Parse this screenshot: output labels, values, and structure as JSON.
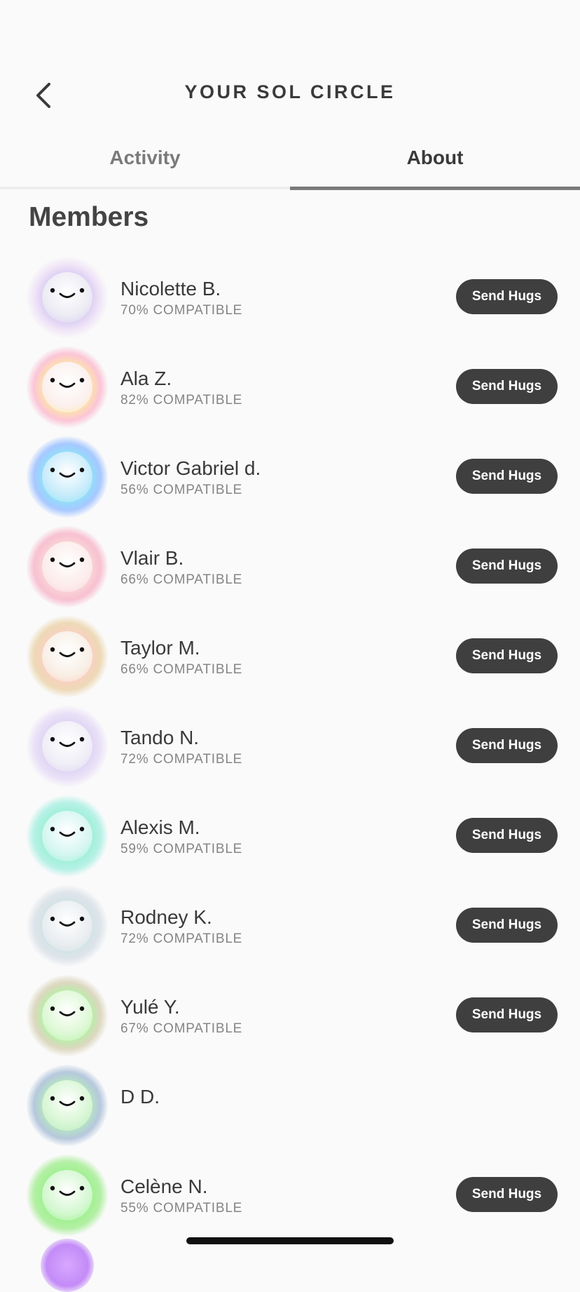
{
  "header": {
    "title": "YOUR SOL CIRCLE",
    "back_icon": "chevron-left-icon"
  },
  "tabs": [
    {
      "label": "Activity",
      "active": false
    },
    {
      "label": "About",
      "active": true
    }
  ],
  "section_title": "Members",
  "send_label": "Send Hugs",
  "members": [
    {
      "name": "Nicolette B.",
      "compat": "70% COMPATIBLE",
      "can_send": true,
      "center": "#ecebf3",
      "glow": "#d6c8f2",
      "edge": "#f0e6f6"
    },
    {
      "name": "Ala Z.",
      "compat": "82% COMPATIBLE",
      "can_send": true,
      "center": "#fbf0ee",
      "glow": "#fde7a6",
      "edge": "#f9c6d6"
    },
    {
      "name": "Victor Gabriel d.",
      "compat": "56% COMPATIBLE",
      "can_send": true,
      "center": "#c8ebfa",
      "glow": "#8fe3f3",
      "edge": "#a9c8ff"
    },
    {
      "name": "Vlair B.",
      "compat": "66% COMPATIBLE",
      "can_send": true,
      "center": "#fbeceb",
      "glow": "#f8d6d6",
      "edge": "#f6c2d2"
    },
    {
      "name": "Taylor M.",
      "compat": "66% COMPATIBLE",
      "can_send": true,
      "center": "#f8efe6",
      "glow": "#fbcfc4",
      "edge": "#ecd9b8"
    },
    {
      "name": "Tando N.",
      "compat": "72% COMPATIBLE",
      "can_send": true,
      "center": "#efeef6",
      "glow": "#dcd1f3",
      "edge": "#eae2f6"
    },
    {
      "name": "Alexis M.",
      "compat": "59% COMPATIBLE",
      "can_send": true,
      "center": "#d6f6f1",
      "glow": "#9eefd3",
      "edge": "#b8f0e6"
    },
    {
      "name": "Rodney K.",
      "compat": "72% COMPATIBLE",
      "can_send": true,
      "center": "#e9edf0",
      "glow": "#cfe2e4",
      "edge": "#dfe5ea"
    },
    {
      "name": "Yulé Y.",
      "compat": "67% COMPATIBLE",
      "can_send": true,
      "center": "#def8d6",
      "glow": "#b4f0a6",
      "edge": "#dcd8c1"
    },
    {
      "name": "D D.",
      "compat": "",
      "can_send": false,
      "center": "#d8f6d4",
      "glow": "#b8e8c0",
      "edge": "#b7c8dc"
    },
    {
      "name": "Celène N.",
      "compat": "55% COMPATIBLE",
      "can_send": true,
      "center": "#d4f7d1",
      "glow": "#9ef08f",
      "edge": "#b6eea8"
    }
  ]
}
